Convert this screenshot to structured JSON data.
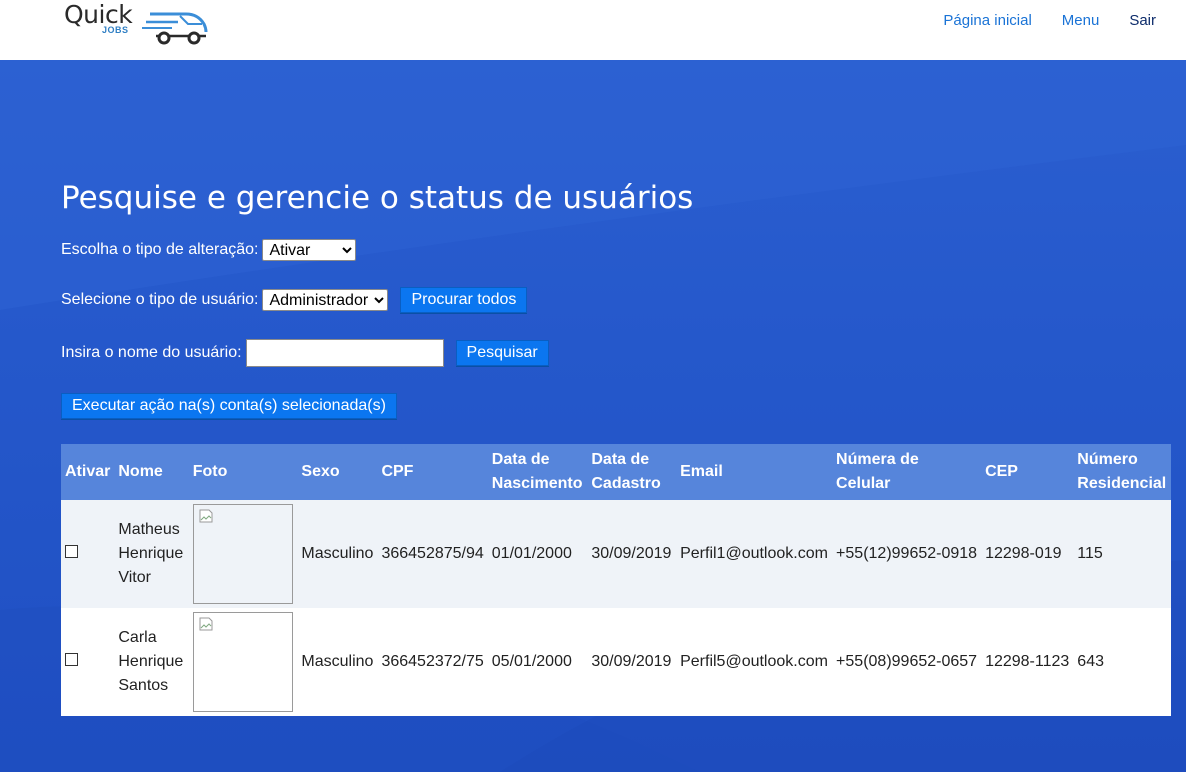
{
  "header": {
    "logo_text": "Quick",
    "logo_sub": "JOBS",
    "nav": [
      {
        "label": "Página inicial"
      },
      {
        "label": "Menu"
      },
      {
        "label": "Sair"
      }
    ]
  },
  "main": {
    "title": "Pesquise e gerencie o status de usuários",
    "alteration": {
      "label": "Escolha o tipo de alteração:",
      "selected": "Ativar"
    },
    "user_type": {
      "label": "Selecione o tipo de usuário:",
      "selected": "Administrador",
      "button": "Procurar todos"
    },
    "name_search": {
      "label": "Insira o nome do usuário:",
      "value": "",
      "button": "Pesquisar"
    },
    "execute_button": "Executar ação na(s) conta(s) selecionada(s)"
  },
  "table": {
    "columns": [
      "Ativar",
      "Nome",
      "Foto",
      "Sexo",
      "CPF",
      "Data de Nascimento",
      "Data de Cadastro",
      "Email",
      "Númera de Celular",
      "CEP",
      "Número Residencial"
    ],
    "rows": [
      {
        "nome": "Matheus Henrique Vitor",
        "sexo": "Masculino",
        "cpf": "366452875/94",
        "nascimento": "01/01/2000",
        "cadastro": "30/09/2019",
        "email": "Perfil1@outlook.com",
        "celular": "+55(12)99652-0918",
        "cep": "12298-019",
        "numero": "115",
        "checked": false
      },
      {
        "nome": "Carla Henrique Santos",
        "sexo": "Masculino",
        "cpf": "366452372/75",
        "nascimento": "05/01/2000",
        "cadastro": "30/09/2019",
        "email": "Perfil5@outlook.com",
        "celular": "+55(08)99652-0657",
        "cep": "12298-1123",
        "numero": "643",
        "checked": false
      }
    ]
  },
  "colors": {
    "hero": "#2558cb",
    "button": "#0b76f0",
    "table_header": "#5685db",
    "nav_link": "#1a73d6"
  }
}
